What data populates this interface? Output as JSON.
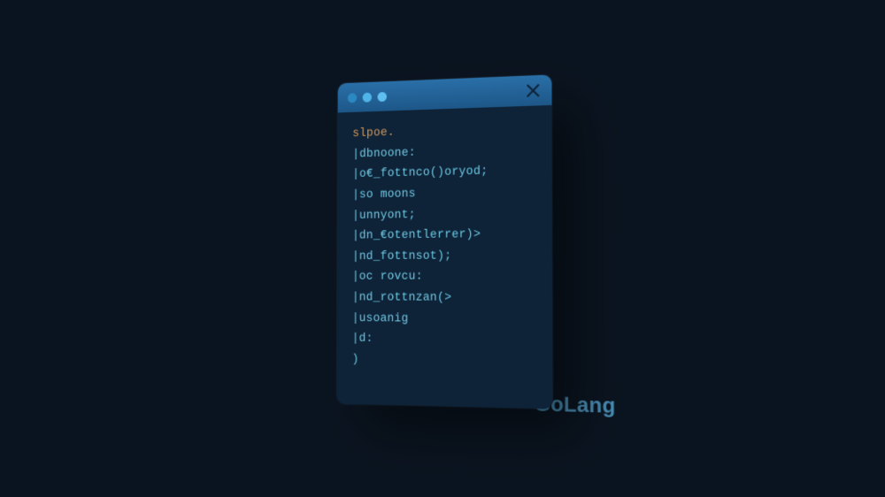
{
  "label": "GoLang",
  "code": {
    "line0": "slpoe.",
    "lines": [
      "|dbnoone:",
      "|o€_fottnco()oryod;",
      "|so moons",
      "|unnyont;",
      "|dn_€otentlerrer)>",
      "|nd_fottnsot);",
      "|oc rovcu:",
      "|nd_rottnzan(>",
      "|usoanig",
      "|d:",
      ")"
    ]
  }
}
